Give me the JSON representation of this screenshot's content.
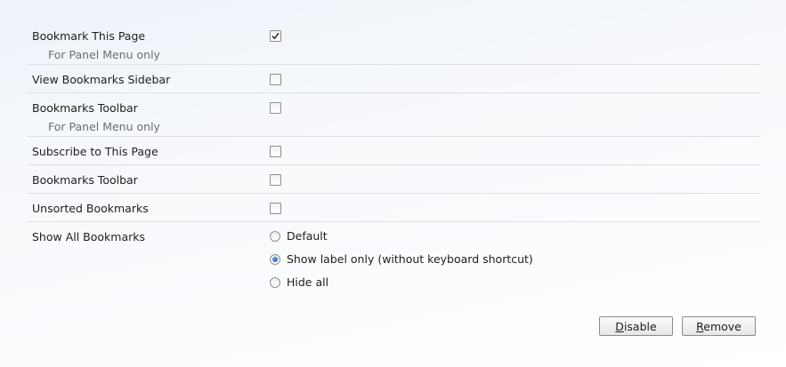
{
  "rows": [
    {
      "label": "Bookmark This Page",
      "note": "For Panel Menu only",
      "checked": true
    },
    {
      "label": "View Bookmarks Sidebar",
      "checked": false
    },
    {
      "label": "Bookmarks Toolbar",
      "note": "For Panel Menu only",
      "checked": false
    },
    {
      "label": "Subscribe to This Page",
      "checked": false
    },
    {
      "label": "Bookmarks Toolbar",
      "checked": false
    },
    {
      "label": "Unsorted Bookmarks",
      "checked": false
    }
  ],
  "show_all": {
    "label": "Show All Bookmarks",
    "options": [
      "Default",
      "Show label only (without keyboard shortcut)",
      "Hide all"
    ],
    "selected_index": 1
  },
  "buttons": {
    "disable": {
      "mnemonic": "D",
      "rest": "isable"
    },
    "remove": {
      "mnemonic": "R",
      "rest": "emove"
    }
  }
}
